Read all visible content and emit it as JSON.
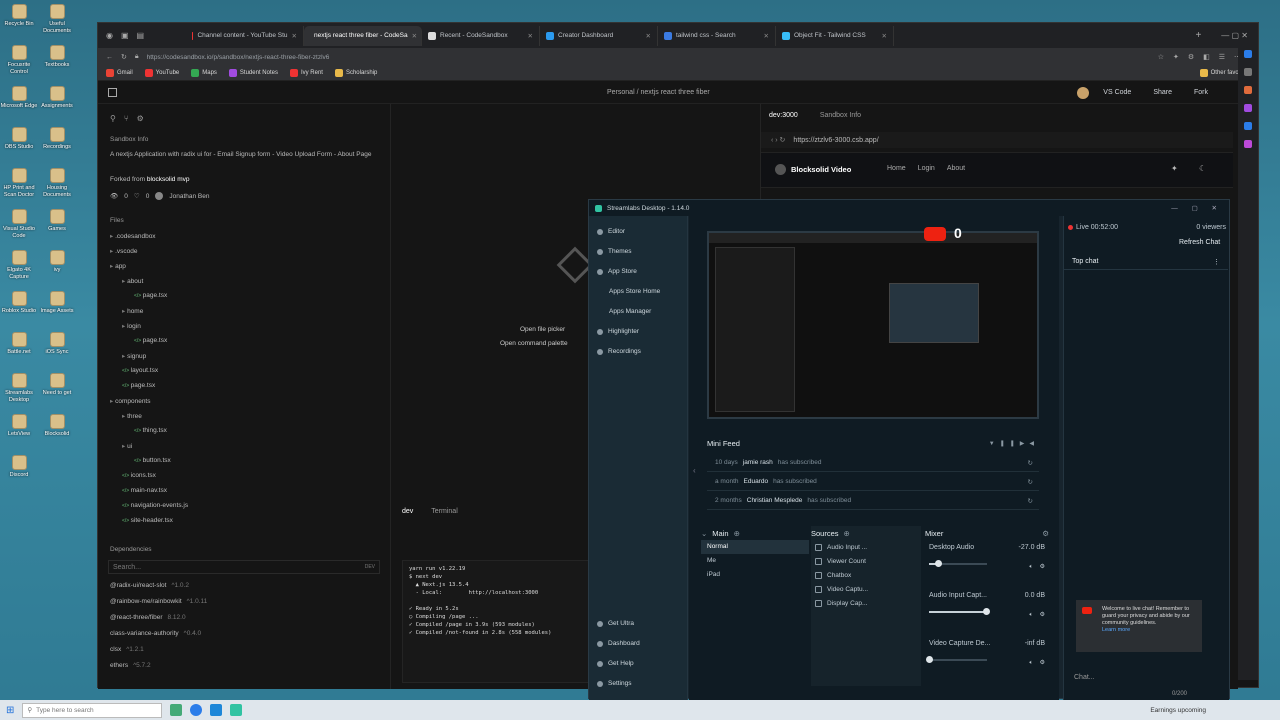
{
  "desktop": {
    "icons": [
      "Recycle Bin",
      "Useful Documents",
      "Focusrite Control",
      "Textbooks",
      "Microsoft Edge",
      "Assignments",
      "OBS Studio",
      "Recordings",
      "HP Print and Scan Doctor",
      "Housing Documents",
      "Visual Studio Code",
      "Games",
      "Elgato 4K Capture",
      "ivy",
      "Roblox Studio",
      "Image Assets",
      "Battle.net",
      "iOS Sync",
      "Streamlabs Desktop",
      "Need to get",
      "LetsView",
      "Blocksolid",
      "Discord"
    ]
  },
  "browser": {
    "tabs": [
      {
        "label": "Channel content - YouTube Stu",
        "color": "#e33"
      },
      {
        "label": "nextjs react three fiber - CodeSa",
        "color": "#fff",
        "active": true
      },
      {
        "label": "Recent - CodeSandbox",
        "color": "#ddd"
      },
      {
        "label": "Creator Dashboard",
        "color": "#2b9aef"
      },
      {
        "label": "tailwind css - Search",
        "color": "#3b7be2"
      },
      {
        "label": "Object Fit - Tailwind CSS",
        "color": "#38bdf8"
      }
    ],
    "url": "https://codesandbox.io/p/sandbox/nextjs-react-three-fiber-ztzlv6",
    "bookmarks": [
      "Gmail",
      "YouTube",
      "Maps",
      "Student Notes",
      "Ivy Rent",
      "Scholarship"
    ],
    "other_favorites": "Other favorites"
  },
  "csb": {
    "breadcrumb": "Personal / nextjs react three fiber",
    "vs_code": "VS Code",
    "share": "Share",
    "fork": "Fork",
    "sandbox_info_title": "Sandbox Info",
    "description": "A nextjs Application with radix ui for - Email Signup form - Video Upload Form - About Page",
    "forked_from_label": "Forked from",
    "forked_from": "blocksolid mvp",
    "views": "0",
    "likes": "0",
    "author": "Jonathan Ben",
    "files_title": "Files",
    "files": [
      {
        "name": ".codesandbox",
        "type": "folder",
        "indent": 0
      },
      {
        "name": ".vscode",
        "type": "folder",
        "indent": 0
      },
      {
        "name": "app",
        "type": "folder",
        "indent": 0
      },
      {
        "name": "about",
        "type": "folder",
        "indent": 1
      },
      {
        "name": "page.tsx",
        "type": "file",
        "indent": 2
      },
      {
        "name": "home",
        "type": "folder",
        "indent": 1
      },
      {
        "name": "login",
        "type": "folder",
        "indent": 1
      },
      {
        "name": "page.tsx",
        "type": "file",
        "indent": 2
      },
      {
        "name": "signup",
        "type": "folder",
        "indent": 1
      },
      {
        "name": "layout.tsx",
        "type": "file",
        "indent": 1
      },
      {
        "name": "page.tsx",
        "type": "file",
        "indent": 1
      },
      {
        "name": "components",
        "type": "folder",
        "indent": 0
      },
      {
        "name": "three",
        "type": "folder",
        "indent": 1
      },
      {
        "name": "thing.tsx",
        "type": "file",
        "indent": 2
      },
      {
        "name": "ui",
        "type": "folder",
        "indent": 1
      },
      {
        "name": "button.tsx",
        "type": "file",
        "indent": 2
      },
      {
        "name": "icons.tsx",
        "type": "file",
        "indent": 1
      },
      {
        "name": "main-nav.tsx",
        "type": "file",
        "indent": 1
      },
      {
        "name": "navigation-events.js",
        "type": "file",
        "indent": 1
      },
      {
        "name": "site-header.tsx",
        "type": "file",
        "indent": 1
      }
    ],
    "deps_title": "Dependencies",
    "search_placeholder": "Search...",
    "dev_tag": "DEV",
    "dependencies": [
      {
        "name": "@radix-ui/react-slot",
        "ver": "^1.0.2"
      },
      {
        "name": "@rainbow-me/rainbowkit",
        "ver": "^1.0.11"
      },
      {
        "name": "@react-three/fiber",
        "ver": "8.12.0"
      },
      {
        "name": "class-variance-authority",
        "ver": "^0.4.0"
      },
      {
        "name": "clsx",
        "ver": "^1.2.1"
      },
      {
        "name": "ethers",
        "ver": "^5.7.2"
      }
    ],
    "open_file_picker": "Open file picker",
    "open_command_palette": "Open command palette",
    "terminal_tabs": [
      "dev",
      "Terminal"
    ],
    "terminal_lines": [
      "yarn run v1.22.19",
      "$ next dev",
      "  ▲ Next.js 13.5.4",
      "  - Local:        http://localhost:3000",
      "",
      "✓ Ready in 5.2s",
      "○ Compiling /page ...",
      "✓ Compiled /page in 3.9s (593 modules)",
      "✓ Compiled /not-found in 2.8s (558 modules)"
    ],
    "preview_tabs": [
      "dev:3000",
      "Sandbox Info"
    ],
    "preview_url": "https://ztzlv6-3000.csb.app/",
    "site_name": "Blocksolid Video",
    "site_nav": [
      "Home",
      "Login",
      "About"
    ]
  },
  "streamlabs": {
    "title": "Streamlabs Desktop - 1.14.0",
    "nav": [
      "Editor",
      "Themes",
      "App Store",
      "Apps Store Home",
      "Apps Manager",
      "Highlighter",
      "Recordings"
    ],
    "nav_bottom": [
      "Get Ultra",
      "Dashboard",
      "Get Help",
      "Settings"
    ],
    "badge_count": "0",
    "mini_feed_title": "Mini Feed",
    "feed": [
      {
        "time": "10 days",
        "name": "jamie rash",
        "action": "has subscribed"
      },
      {
        "time": "a month",
        "name": "Eduardo",
        "action": "has subscribed"
      },
      {
        "time": "2 months",
        "name": "Christian Mesplede",
        "action": "has subscribed"
      }
    ],
    "scenes_title": "Main",
    "scenes": [
      "Normal",
      "Me",
      "iPad"
    ],
    "sources_title": "Sources",
    "sources": [
      "Audio Input ...",
      "Viewer Count",
      "Chatbox",
      "Video Captu...",
      "Display Cap..."
    ],
    "mixer_title": "Mixer",
    "mixer": [
      {
        "name": "Desktop Audio",
        "db": "-27.0 dB",
        "level": 0.15
      },
      {
        "name": "Audio Input Capt...",
        "db": "0.0 dB",
        "level": 0.98
      },
      {
        "name": "Video Capture De...",
        "db": "-inf dB",
        "level": 0
      }
    ],
    "live_time": "Live 00:52:00",
    "viewers": "0 viewers",
    "refresh_chat": "Refresh Chat",
    "top_chat": "Top chat",
    "chat_notice": "Welcome to live chat! Remember to guard your privacy and abide by our community guidelines.",
    "learn_more": "Learn more",
    "chat_placeholder": "Chat...",
    "char_count": "0/200"
  },
  "taskbar": {
    "search_placeholder": "Type here to search",
    "earnings": "Earnings upcoming"
  }
}
